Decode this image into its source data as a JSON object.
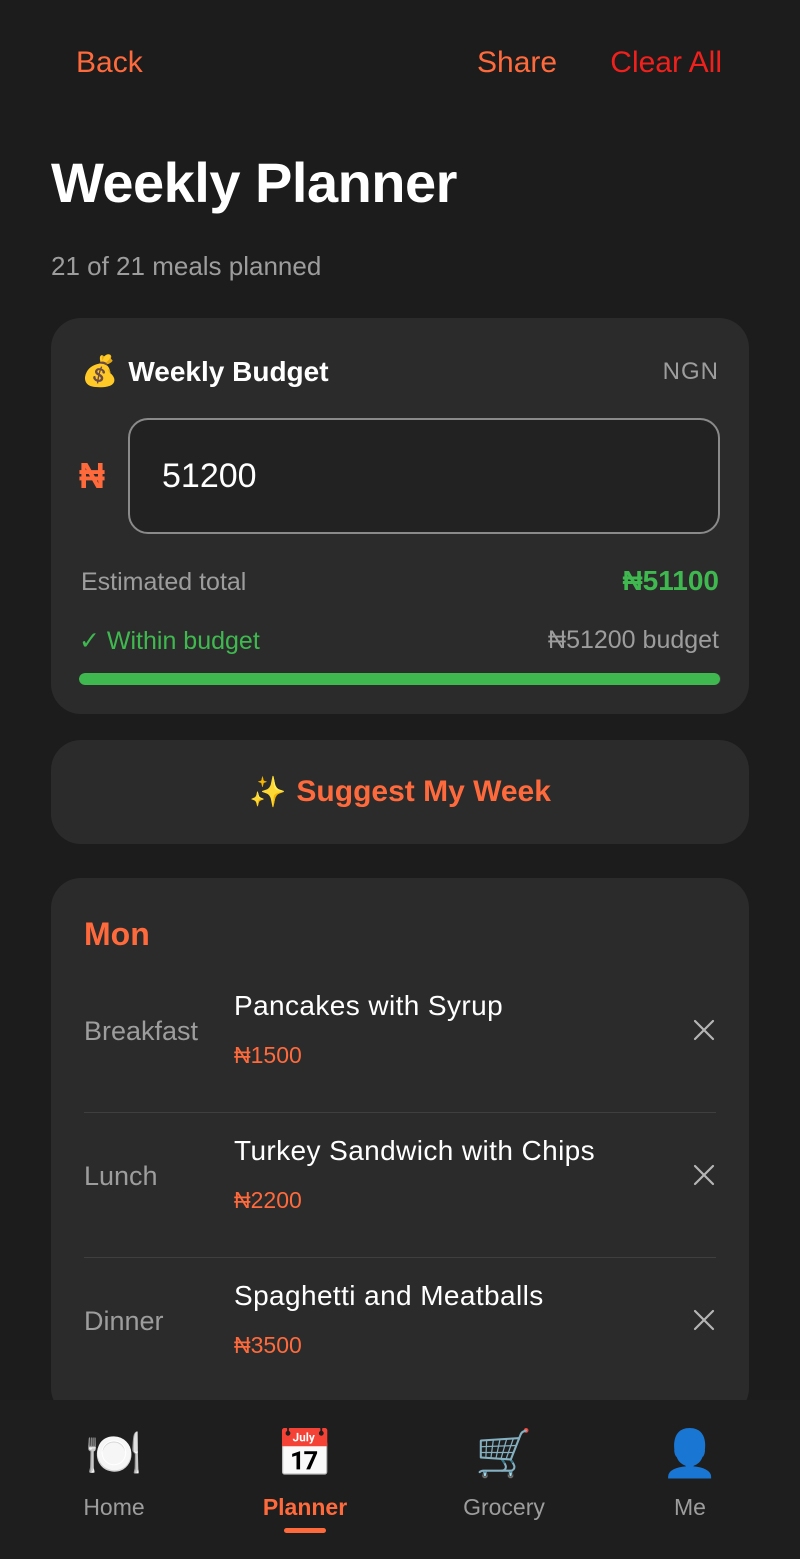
{
  "header": {
    "back_label": "Back",
    "share_label": "Share",
    "clear_label": "Clear All"
  },
  "page": {
    "title": "Weekly Planner",
    "subtitle": "21 of 21 meals planned"
  },
  "budget": {
    "icon": "money-bag-icon",
    "label": "Weekly Budget",
    "currency": "NGN",
    "symbol": "₦",
    "input_value": "51200",
    "estimated_label": "Estimated total",
    "estimated_value": "₦51100",
    "status": "✓ Within budget",
    "limit": "₦51200 budget",
    "progress_fraction": 0.998,
    "progress_color": "#3fb94f"
  },
  "suggest": {
    "icon": "sparkles-icon",
    "label": "Suggest My Week"
  },
  "day": {
    "name": "Mon",
    "meals": [
      {
        "slot": "Breakfast",
        "name": "Pancakes with Syrup",
        "price": "₦1500"
      },
      {
        "slot": "Lunch",
        "name": "Turkey Sandwich with Chips",
        "price": "₦2200"
      },
      {
        "slot": "Dinner",
        "name": "Spaghetti and Meatballs",
        "price": "₦3500"
      }
    ]
  },
  "nav": {
    "items": [
      {
        "label": "Home",
        "icon": "plate-icon"
      },
      {
        "label": "Planner",
        "icon": "calendar-icon"
      },
      {
        "label": "Grocery",
        "icon": "cart-icon"
      },
      {
        "label": "Me",
        "icon": "person-icon"
      }
    ],
    "active": "Planner"
  },
  "colors": {
    "accent": "#ff6a3d",
    "danger": "#f0201c",
    "success": "#3fb94f",
    "card": "#2b2b2b",
    "background": "#1c1c1c"
  }
}
